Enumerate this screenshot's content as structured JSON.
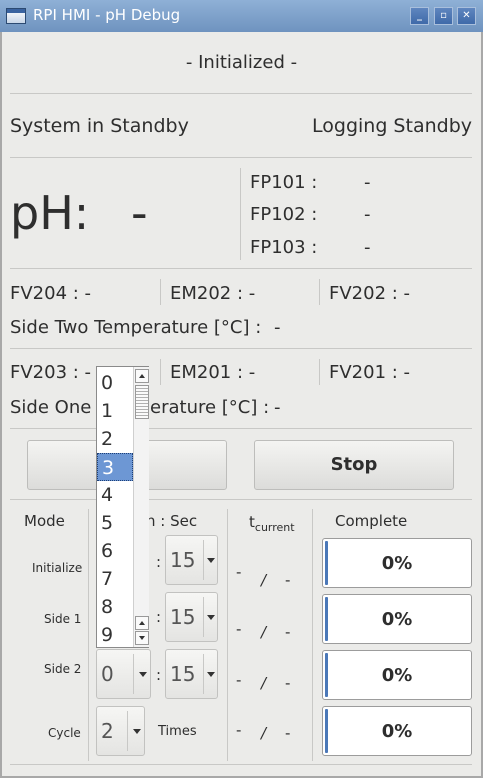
{
  "window": {
    "title": "RPI HMI - pH Debug"
  },
  "status": {
    "init": "- Initialized -",
    "system": "System in Standby",
    "logging": "Logging Standby"
  },
  "ph": {
    "label": "pH:",
    "value": "-"
  },
  "fp": [
    {
      "label": "FP101 :",
      "value": "-"
    },
    {
      "label": "FP102 :",
      "value": "-"
    },
    {
      "label": "FP103 :",
      "value": "-"
    }
  ],
  "side_two": {
    "valves": [
      {
        "label": "FV204 : -"
      },
      {
        "label": "EM202 : -"
      },
      {
        "label": "FV202 : -"
      }
    ],
    "temp_label": "Side Two Temperature [°C] :",
    "temp_value": "-"
  },
  "side_one": {
    "valves": [
      {
        "label": "FV203 : -"
      },
      {
        "label": "EM201 : -"
      },
      {
        "label": "FV201 : -"
      }
    ],
    "temp_label_a": "Side One",
    "temp_label_b": "erature [°C] :",
    "temp_value": "-"
  },
  "buttons": {
    "start": "",
    "stop": "Stop"
  },
  "table": {
    "mode_header": "Mode",
    "time_header_partial": "n : Sec",
    "tcurrent_base": "t",
    "tcurrent_sub": "current",
    "complete_header": "Complete",
    "rows": [
      {
        "mode": "Initialize",
        "sec": "15",
        "cur": "-",
        "slash": "/",
        "tot": "-",
        "complete": "0%",
        "progress": 0.02
      },
      {
        "mode": "Side 1",
        "sec": "15",
        "cur": "-",
        "slash": "/",
        "tot": "-",
        "complete": "0%",
        "progress": 0.02
      },
      {
        "mode": "Side 2",
        "min": "0",
        "sec": "15",
        "cur": "-",
        "slash": "/",
        "tot": "-",
        "complete": "0%",
        "progress": 0.02
      },
      {
        "mode": "Cycle",
        "times_value": "2",
        "times_label": "Times",
        "cur": "-",
        "slash": "/",
        "tot": "-",
        "complete": "0%",
        "progress": 0.02
      }
    ],
    "colon": ":"
  },
  "dropdown": {
    "options": [
      "0",
      "1",
      "2",
      "3",
      "4",
      "5",
      "6",
      "7",
      "8",
      "9"
    ],
    "selected": "3"
  },
  "colors": {
    "accent": "#4b78b8",
    "selection": "#6d97d4",
    "titlebar": "#7a9cc8"
  }
}
